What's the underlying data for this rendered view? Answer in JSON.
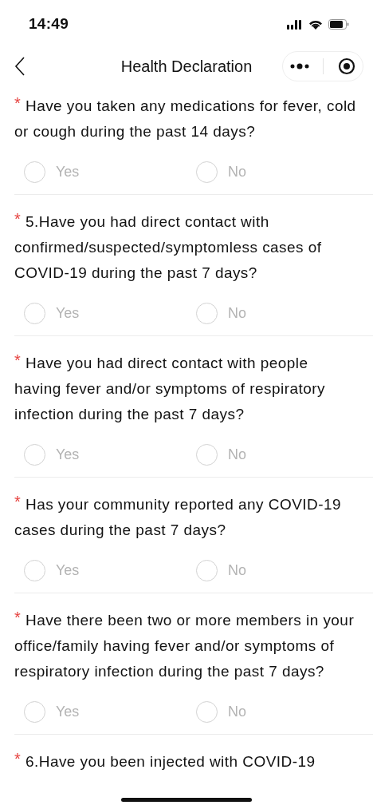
{
  "status_bar": {
    "time": "14:49"
  },
  "nav": {
    "title": "Health Declaration"
  },
  "questions": [
    {
      "mark": "*",
      "text": "Have you taken any medications for fever, cold or cough during the past 14 days?",
      "options": [
        {
          "label": "Yes",
          "selected": false
        },
        {
          "label": "No",
          "selected": false
        }
      ]
    },
    {
      "mark": "*",
      "text": "5.Have you had direct contact with confirmed/suspected/symptomless cases of COVID-19 during the past 7 days?",
      "options": [
        {
          "label": "Yes",
          "selected": false
        },
        {
          "label": "No",
          "selected": false
        }
      ]
    },
    {
      "mark": "*",
      "text": "Have you had direct contact with people having fever and/or symptoms of respiratory infection during the past 7 days?",
      "options": [
        {
          "label": "Yes",
          "selected": false
        },
        {
          "label": "No",
          "selected": false
        }
      ]
    },
    {
      "mark": "*",
      "text": "Has your community reported any COVID-19 cases during the past 7 days?",
      "options": [
        {
          "label": "Yes",
          "selected": false
        },
        {
          "label": "No",
          "selected": false
        }
      ]
    },
    {
      "mark": "*",
      "text": "Have there been two or more members in your office/family having fever and/or symptoms of respiratory infection during the past 7 days?",
      "options": [
        {
          "label": "Yes",
          "selected": false
        },
        {
          "label": "No",
          "selected": false
        }
      ]
    },
    {
      "mark": "*",
      "text": "6.Have you been injected with COVID-19"
    }
  ]
}
